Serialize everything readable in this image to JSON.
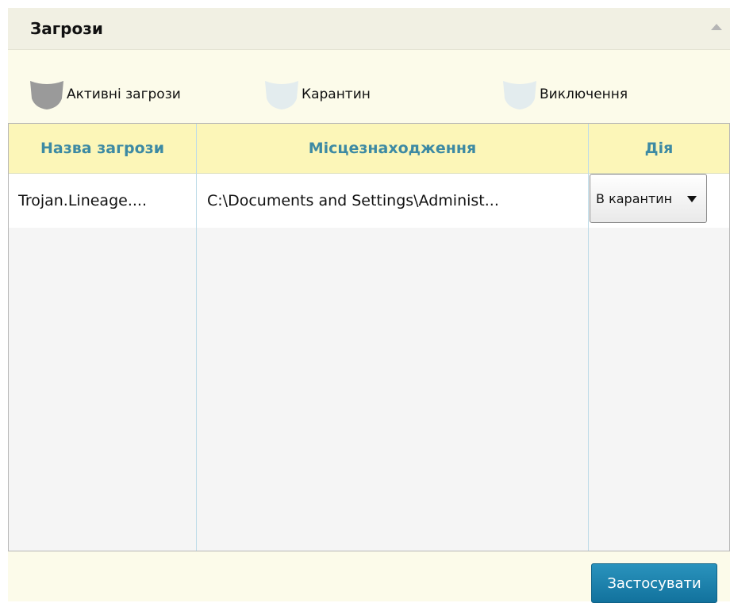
{
  "panel": {
    "title": "Загрози"
  },
  "tabs": [
    {
      "label": "Активні загрози",
      "icon": "shield-icon",
      "color": "#9a9a9a"
    },
    {
      "label": "Карантин",
      "icon": "shield-icon",
      "color": "#e3ecee"
    },
    {
      "label": "Виключення",
      "icon": "shield-icon",
      "color": "#e3ecee"
    }
  ],
  "table": {
    "columns": [
      "Назва загрози",
      "Місцезнаходження",
      "Дія"
    ],
    "rows": [
      {
        "name": "Trojan.Lineage....",
        "location": "C:\\Documents and Settings\\Administ...",
        "action": "В карантин"
      }
    ]
  },
  "footer": {
    "apply_label": "Застосувати"
  },
  "colors": {
    "header_text": "#3d8aa3",
    "header_bg": "#fcf6b8",
    "accent": "#1a7fab"
  }
}
